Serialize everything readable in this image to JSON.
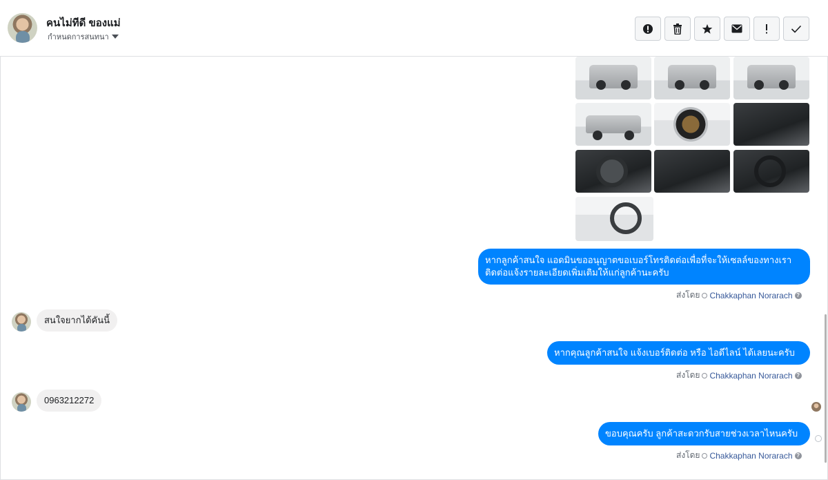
{
  "header": {
    "contact_name": "คนไม่ทีดี ของแม่",
    "conversation_label": "กำหนดการสนทนา",
    "toolbar": [
      {
        "icon": "alert-circle-icon",
        "glyph": "!"
      },
      {
        "icon": "trash-icon",
        "glyph": ""
      },
      {
        "icon": "star-icon",
        "glyph": "★"
      },
      {
        "icon": "envelope-icon",
        "glyph": "✉"
      },
      {
        "icon": "exclamation-icon",
        "glyph": "!"
      },
      {
        "icon": "checkmark-icon",
        "glyph": "✓"
      }
    ]
  },
  "photos": [
    {
      "type": "truck-rear"
    },
    {
      "type": "truck-rear"
    },
    {
      "type": "truck-rear"
    },
    {
      "type": "truck-side"
    },
    {
      "type": "wheel"
    },
    {
      "type": "door-interior"
    },
    {
      "type": "dashboard"
    },
    {
      "type": "gear-shift"
    },
    {
      "type": "steering-wheel"
    },
    {
      "type": "cabin-interior"
    }
  ],
  "messages": [
    {
      "direction": "out",
      "lines": [
        "หากลูกค้าสนใจ แอดมินขออนุญาตขอเบอร์โทรติดต่อเพื่อที่จะให้เซลล์ของทางเรา",
        "ติดต่อแจ้งรายละเอียดเพิ่มเติมให้แก่ลูกค้านะครับ"
      ],
      "sent_by_label": "ส่งโดย",
      "agent": "Chakkaphan Norarach"
    },
    {
      "direction": "in",
      "text": "สนใจยากได้คันนี้"
    },
    {
      "direction": "out",
      "lines": [
        "หากคุณลูกค้าสนใจ แจ้งเบอร์ติดต่อ หรือ ไอดีไลน์ ได้เลยนะครับ"
      ],
      "sent_by_label": "ส่งโดย",
      "agent": "Chakkaphan Norarach"
    },
    {
      "direction": "in",
      "text": "0963212272"
    },
    {
      "direction": "out",
      "lines": [
        "ขอบคุณครับ ลูกค้าสะดวกรับสายช่วงเวลาไหนครับ"
      ],
      "sent_by_label": "ส่งโดย",
      "agent": "Chakkaphan Norarach"
    }
  ],
  "colors": {
    "outgoing_bubble": "#0084ff",
    "incoming_bubble": "#f1f0f0",
    "agent_link": "#365899"
  }
}
